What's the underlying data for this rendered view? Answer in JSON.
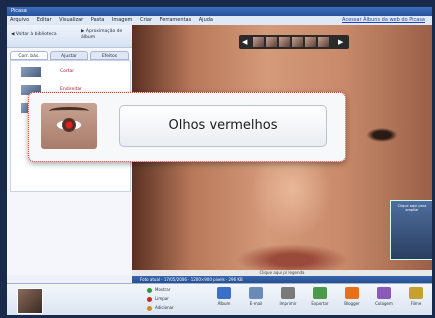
{
  "window": {
    "title": "Picasa"
  },
  "menu": {
    "items": [
      "Arquivo",
      "Editar",
      "Visualizar",
      "Pasta",
      "Imagem",
      "Criar",
      "Ferramentas",
      "Ajuda"
    ],
    "right_link": "Acessar Álbuns da web do Picasa"
  },
  "left_panel": {
    "back_label": "Voltar à biblioteca",
    "forward_label": "Aproximação de álbum",
    "tabs": [
      "Corr. bás.",
      "Ajustar",
      "Efeitos"
    ],
    "fixes": [
      "Cortar",
      "Endireitar",
      "Olhos verm."
    ]
  },
  "overlay": {
    "feature_label": "Olhos vermelhos"
  },
  "viewer": {
    "caption": "Clique aqui p/ legenda",
    "status": "Foto atual · 17/05/2006 · 1200×900 pixels · 296 KB",
    "pip_label": "Clique aqui para ampliar"
  },
  "tray": {
    "options": [
      "Mostrar",
      "Limpar",
      "Adicionar"
    ],
    "tools": [
      "Álbum",
      "E-mail",
      "Imprimir",
      "Exportar",
      "Blogger",
      "Colagem",
      "Filme"
    ]
  },
  "colors": {
    "overlay_border": "#d23a2a",
    "accent": "#28529a"
  },
  "icons": [
    "back-arrow-icon",
    "forward-arrow-icon",
    "red-eye-icon",
    "album-icon",
    "email-icon",
    "print-icon",
    "export-icon",
    "blogger-icon",
    "collage-icon",
    "movie-icon"
  ]
}
